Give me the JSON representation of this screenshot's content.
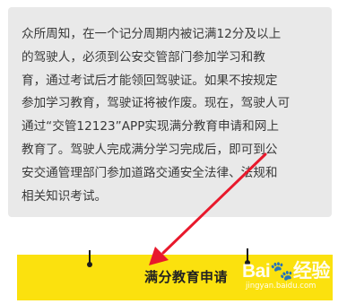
{
  "info_card": {
    "lines": [
      "众所周知，在一个记分周期内被记满12分及以上",
      "的驾驶人，必须到公安交管部门参加学习和教",
      "育，通过考试后才能领回驾驶证。如果不按规定",
      "参加学习教育，驾驶证将被作废。现在，驾驶人可",
      "通过“交管12123”APP实现满分教育申请和网上",
      "教育了。驾驶人完成满分学习完成后，即可到公",
      "安交通管理部门参加道路交通安全法律、法规和",
      "相关知识考试。"
    ]
  },
  "action": {
    "apply_label": "满分教育申请"
  },
  "annotation": {
    "arrow_color": "#e8192c"
  },
  "watermark": {
    "logo_text": "Bai🐾经验",
    "sub_text": "jingyan.baidu.com"
  },
  "colors": {
    "button_bg": "#fbe10e",
    "card_bg": "#e9e9e9"
  }
}
